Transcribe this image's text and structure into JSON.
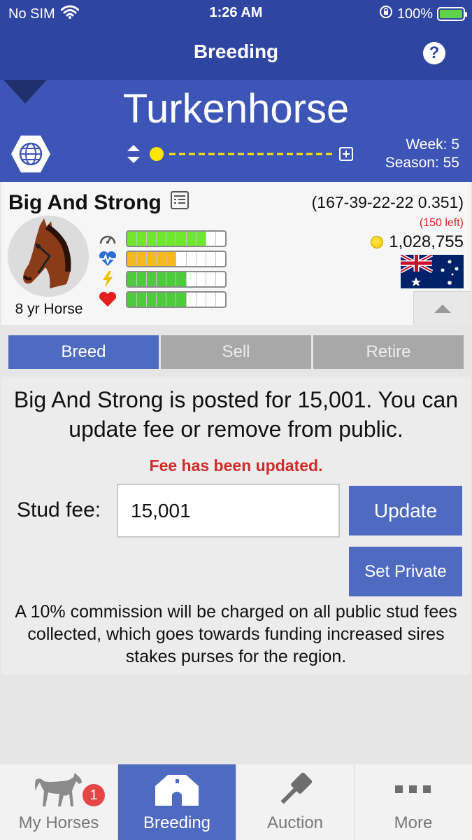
{
  "status_bar": {
    "carrier": "No SIM",
    "time": "1:26 AM",
    "battery": "100%"
  },
  "nav": {
    "title": "Breeding",
    "help_icon": "question-circle-icon"
  },
  "header": {
    "stable_name": "Turkenhorse",
    "week": "Week: 5",
    "season": "Season: 55"
  },
  "horse": {
    "name": "Big And Strong",
    "age": "8 yr Horse",
    "record": "(167-39-22-22 0.351)",
    "left": "(150 left)",
    "money": "1,028,755",
    "country": "Australia",
    "stats": [
      {
        "icon": "speedometer-icon",
        "filled": 8,
        "total": 10,
        "color": "#6ee82b"
      },
      {
        "icon": "heartbeat-icon",
        "filled": 5,
        "total": 10,
        "color": "#f7b91a"
      },
      {
        "icon": "lightning-icon",
        "filled": 6,
        "total": 10,
        "color": "#4ccc3a"
      },
      {
        "icon": "heart-icon",
        "filled": 6,
        "total": 10,
        "color": "#4ccc3a"
      }
    ]
  },
  "tabs": [
    "Breed",
    "Sell",
    "Retire"
  ],
  "breed": {
    "message": "Big And Strong is posted for 15,001. You can update fee or remove from public.",
    "notice": "Fee has been updated.",
    "fee_label": "Stud fee:",
    "fee_value": "15,001",
    "update_label": "Update",
    "private_label": "Set Private",
    "commission": "A 10% commission will be charged on all public stud fees collected, which goes towards funding increased sires stakes purses for the region."
  },
  "tabbar": {
    "items": [
      {
        "label": "My Horses",
        "icon": "horse-icon",
        "badge": "1"
      },
      {
        "label": "Breeding",
        "icon": "barn-icon"
      },
      {
        "label": "Auction",
        "icon": "gavel-icon"
      },
      {
        "label": "More",
        "icon": "ellipsis-icon"
      }
    ]
  },
  "colors": {
    "nav": "#2f45a2",
    "header": "#3e55b8",
    "accent": "#4f6ac1",
    "error": "#d22b2b"
  }
}
